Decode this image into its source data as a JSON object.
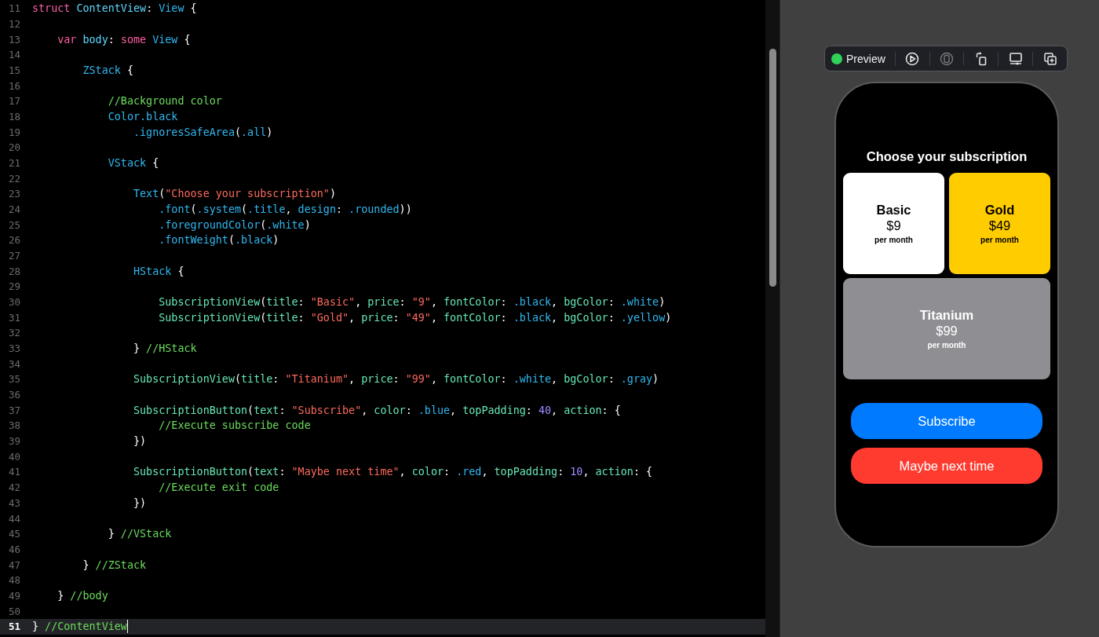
{
  "editor": {
    "lines": [
      {
        "number": "11",
        "current": false,
        "tokens": [
          {
            "kind": "keyword",
            "text": "struct"
          },
          {
            "kind": "declaration",
            "text": " ContentView"
          },
          {
            "kind": "plain",
            "text": ": "
          },
          {
            "kind": "type",
            "text": "View"
          },
          {
            "kind": "plain",
            "text": " {"
          }
        ]
      },
      {
        "number": "12",
        "current": false
      },
      {
        "number": "13",
        "current": false,
        "tokens": [
          {
            "kind": "keyword",
            "text": "    var"
          },
          {
            "kind": "declaration",
            "text": " body"
          },
          {
            "kind": "plain",
            "text": ": "
          },
          {
            "kind": "keyword",
            "text": "some"
          },
          {
            "kind": "type",
            "text": " View"
          },
          {
            "kind": "plain",
            "text": " {"
          }
        ]
      },
      {
        "number": "14",
        "current": false
      },
      {
        "number": "15",
        "current": false,
        "tokens": [
          {
            "kind": "type",
            "text": "        ZStack"
          },
          {
            "kind": "plain",
            "text": " {"
          }
        ]
      },
      {
        "number": "16",
        "current": false
      },
      {
        "number": "17",
        "current": false,
        "tokens": [
          {
            "kind": "comment",
            "text": "            //Background color"
          }
        ]
      },
      {
        "number": "18",
        "current": false,
        "tokens": [
          {
            "kind": "type",
            "text": "            Color.black"
          }
        ]
      },
      {
        "number": "19",
        "current": false,
        "tokens": [
          {
            "kind": "member",
            "text": "                .ignoresSafeArea"
          },
          {
            "kind": "plain",
            "text": "("
          },
          {
            "kind": "member",
            "text": ".all"
          },
          {
            "kind": "plain",
            "text": ")"
          }
        ]
      },
      {
        "number": "20",
        "current": false
      },
      {
        "number": "21",
        "current": false,
        "tokens": [
          {
            "kind": "type",
            "text": "            VStack"
          },
          {
            "kind": "plain",
            "text": " {"
          }
        ]
      },
      {
        "number": "22",
        "current": false
      },
      {
        "number": "23",
        "current": false,
        "tokens": [
          {
            "kind": "type",
            "text": "                Text"
          },
          {
            "kind": "plain",
            "text": "("
          },
          {
            "kind": "string",
            "text": "\"Choose your subscription\""
          },
          {
            "kind": "plain",
            "text": ")"
          }
        ]
      },
      {
        "number": "24",
        "current": false,
        "tokens": [
          {
            "kind": "member",
            "text": "                    .font"
          },
          {
            "kind": "plain",
            "text": "("
          },
          {
            "kind": "member",
            "text": ".system"
          },
          {
            "kind": "plain",
            "text": "("
          },
          {
            "kind": "member",
            "text": ".title"
          },
          {
            "kind": "plain",
            "text": ","
          },
          {
            "kind": "member",
            "text": " design"
          },
          {
            "kind": "plain",
            "text": ":"
          },
          {
            "kind": "member",
            "text": " .rounded"
          },
          {
            "kind": "plain",
            "text": "))"
          }
        ]
      },
      {
        "number": "25",
        "current": false,
        "tokens": [
          {
            "kind": "member",
            "text": "                    .foregroundColor"
          },
          {
            "kind": "plain",
            "text": "("
          },
          {
            "kind": "member",
            "text": ".white"
          },
          {
            "kind": "plain",
            "text": ")"
          }
        ]
      },
      {
        "number": "26",
        "current": false,
        "tokens": [
          {
            "kind": "member",
            "text": "                    .fontWeight"
          },
          {
            "kind": "plain",
            "text": "("
          },
          {
            "kind": "member",
            "text": ".black"
          },
          {
            "kind": "plain",
            "text": ")"
          }
        ]
      },
      {
        "number": "27",
        "current": false
      },
      {
        "number": "28",
        "current": false,
        "tokens": [
          {
            "kind": "type",
            "text": "                HStack"
          },
          {
            "kind": "plain",
            "text": " {"
          }
        ]
      },
      {
        "number": "29",
        "current": false
      },
      {
        "number": "30",
        "current": false,
        "tokens": [
          {
            "kind": "project",
            "text": "                    SubscriptionView"
          },
          {
            "kind": "plain",
            "text": "("
          },
          {
            "kind": "project",
            "text": "title"
          },
          {
            "kind": "plain",
            "text": ":"
          },
          {
            "kind": "string",
            "text": " \"Basic\""
          },
          {
            "kind": "plain",
            "text": ","
          },
          {
            "kind": "project",
            "text": " price"
          },
          {
            "kind": "plain",
            "text": ":"
          },
          {
            "kind": "string",
            "text": " \"9\""
          },
          {
            "kind": "plain",
            "text": ","
          },
          {
            "kind": "project",
            "text": " fontColor"
          },
          {
            "kind": "plain",
            "text": ":"
          },
          {
            "kind": "member",
            "text": " .black"
          },
          {
            "kind": "plain",
            "text": ","
          },
          {
            "kind": "project",
            "text": " bgColor"
          },
          {
            "kind": "plain",
            "text": ":"
          },
          {
            "kind": "member",
            "text": " .white"
          },
          {
            "kind": "plain",
            "text": ")"
          }
        ]
      },
      {
        "number": "31",
        "current": false,
        "tokens": [
          {
            "kind": "project",
            "text": "                    SubscriptionView"
          },
          {
            "kind": "plain",
            "text": "("
          },
          {
            "kind": "project",
            "text": "title"
          },
          {
            "kind": "plain",
            "text": ":"
          },
          {
            "kind": "string",
            "text": " \"Gold\""
          },
          {
            "kind": "plain",
            "text": ","
          },
          {
            "kind": "project",
            "text": " price"
          },
          {
            "kind": "plain",
            "text": ":"
          },
          {
            "kind": "string",
            "text": " \"49\""
          },
          {
            "kind": "plain",
            "text": ","
          },
          {
            "kind": "project",
            "text": " fontColor"
          },
          {
            "kind": "plain",
            "text": ":"
          },
          {
            "kind": "member",
            "text": " .black"
          },
          {
            "kind": "plain",
            "text": ","
          },
          {
            "kind": "project",
            "text": " bgColor"
          },
          {
            "kind": "plain",
            "text": ":"
          },
          {
            "kind": "member",
            "text": " .yellow"
          },
          {
            "kind": "plain",
            "text": ")"
          }
        ]
      },
      {
        "number": "32",
        "current": false
      },
      {
        "number": "33",
        "current": false,
        "tokens": [
          {
            "kind": "plain",
            "text": "                }"
          },
          {
            "kind": "comment",
            "text": " //HStack"
          }
        ]
      },
      {
        "number": "34",
        "current": false
      },
      {
        "number": "35",
        "current": false,
        "tokens": [
          {
            "kind": "project",
            "text": "                SubscriptionView"
          },
          {
            "kind": "plain",
            "text": "("
          },
          {
            "kind": "project",
            "text": "title"
          },
          {
            "kind": "plain",
            "text": ":"
          },
          {
            "kind": "string",
            "text": " \"Titanium\""
          },
          {
            "kind": "plain",
            "text": ","
          },
          {
            "kind": "project",
            "text": " price"
          },
          {
            "kind": "plain",
            "text": ":"
          },
          {
            "kind": "string",
            "text": " \"99\""
          },
          {
            "kind": "plain",
            "text": ","
          },
          {
            "kind": "project",
            "text": " fontColor"
          },
          {
            "kind": "plain",
            "text": ":"
          },
          {
            "kind": "member",
            "text": " .white"
          },
          {
            "kind": "plain",
            "text": ","
          },
          {
            "kind": "project",
            "text": " bgColor"
          },
          {
            "kind": "plain",
            "text": ":"
          },
          {
            "kind": "member",
            "text": " .gray"
          },
          {
            "kind": "plain",
            "text": ")"
          }
        ]
      },
      {
        "number": "36",
        "current": false
      },
      {
        "number": "37",
        "current": false,
        "tokens": [
          {
            "kind": "project",
            "text": "                SubscriptionButton"
          },
          {
            "kind": "plain",
            "text": "("
          },
          {
            "kind": "project",
            "text": "text"
          },
          {
            "kind": "plain",
            "text": ":"
          },
          {
            "kind": "string",
            "text": " \"Subscribe\""
          },
          {
            "kind": "plain",
            "text": ","
          },
          {
            "kind": "project",
            "text": " color"
          },
          {
            "kind": "plain",
            "text": ":"
          },
          {
            "kind": "member",
            "text": " .blue"
          },
          {
            "kind": "plain",
            "text": ","
          },
          {
            "kind": "project",
            "text": " topPadding"
          },
          {
            "kind": "plain",
            "text": ":"
          },
          {
            "kind": "number",
            "text": " 40"
          },
          {
            "kind": "plain",
            "text": ","
          },
          {
            "kind": "project",
            "text": " action"
          },
          {
            "kind": "plain",
            "text": ": {"
          }
        ]
      },
      {
        "number": "38",
        "current": false,
        "tokens": [
          {
            "kind": "comment",
            "text": "                    //Execute subscribe code"
          }
        ]
      },
      {
        "number": "39",
        "current": false,
        "tokens": [
          {
            "kind": "plain",
            "text": "                })"
          }
        ]
      },
      {
        "number": "40",
        "current": false
      },
      {
        "number": "41",
        "current": false,
        "tokens": [
          {
            "kind": "project",
            "text": "                SubscriptionButton"
          },
          {
            "kind": "plain",
            "text": "("
          },
          {
            "kind": "project",
            "text": "text"
          },
          {
            "kind": "plain",
            "text": ":"
          },
          {
            "kind": "string",
            "text": " \"Maybe next time\""
          },
          {
            "kind": "plain",
            "text": ","
          },
          {
            "kind": "project",
            "text": " color"
          },
          {
            "kind": "plain",
            "text": ":"
          },
          {
            "kind": "member",
            "text": " .red"
          },
          {
            "kind": "plain",
            "text": ","
          },
          {
            "kind": "project",
            "text": " topPadding"
          },
          {
            "kind": "plain",
            "text": ":"
          },
          {
            "kind": "number",
            "text": " 10"
          },
          {
            "kind": "plain",
            "text": ","
          },
          {
            "kind": "project",
            "text": " action"
          },
          {
            "kind": "plain",
            "text": ": {"
          }
        ]
      },
      {
        "number": "42",
        "current": false,
        "tokens": [
          {
            "kind": "comment",
            "text": "                    //Execute exit code"
          }
        ]
      },
      {
        "number": "43",
        "current": false,
        "tokens": [
          {
            "kind": "plain",
            "text": "                })"
          }
        ]
      },
      {
        "number": "44",
        "current": false
      },
      {
        "number": "45",
        "current": false,
        "tokens": [
          {
            "kind": "plain",
            "text": "            }"
          },
          {
            "kind": "comment",
            "text": " //VStack"
          }
        ]
      },
      {
        "number": "46",
        "current": false
      },
      {
        "number": "47",
        "current": false,
        "tokens": [
          {
            "kind": "plain",
            "text": "        }"
          },
          {
            "kind": "comment",
            "text": " //ZStack"
          }
        ]
      },
      {
        "number": "48",
        "current": false
      },
      {
        "number": "49",
        "current": false,
        "tokens": [
          {
            "kind": "plain",
            "text": "    }"
          },
          {
            "kind": "comment",
            "text": " //body"
          }
        ]
      },
      {
        "number": "50",
        "current": false
      },
      {
        "number": "51",
        "current": true,
        "tokens": [
          {
            "kind": "plain",
            "text": "}"
          },
          {
            "kind": "comment",
            "text": " //ContentView"
          }
        ]
      }
    ]
  },
  "preview": {
    "toolbar": {
      "running": true,
      "label": "Preview",
      "tools": [
        {
          "kind": "play",
          "disabled": false
        },
        {
          "kind": "device",
          "disabled": true
        },
        {
          "kind": "rotate",
          "disabled": false
        },
        {
          "kind": "display",
          "disabled": false
        },
        {
          "kind": "duplicate",
          "disabled": false
        }
      ]
    },
    "screen": {
      "title": "Choose your subscription",
      "cards": [
        {
          "title": "Basic",
          "price": "$9",
          "caption": "per month",
          "color": "#ffffff",
          "kind": "dark"
        },
        {
          "title": "Gold",
          "price": "$49",
          "caption": "per month",
          "color": "#ffcc00",
          "kind": "dark"
        },
        {
          "title": "Titanium",
          "price": "$99",
          "caption": "per month",
          "color": "#8e8e93",
          "kind": "light"
        }
      ],
      "buttons": [
        {
          "label": "Subscribe",
          "color": "#007aff"
        },
        {
          "label": "Maybe next time",
          "color": "#ff3b30"
        }
      ]
    }
  }
}
